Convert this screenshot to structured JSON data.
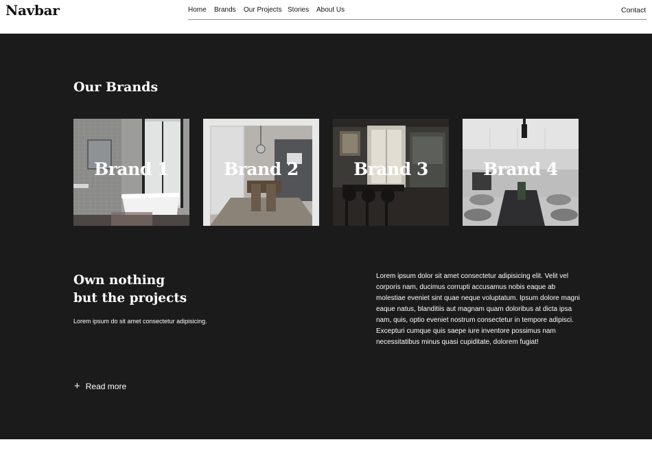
{
  "navbar": {
    "logo": "Navbar",
    "links": [
      "Home",
      "Brands",
      "Our Projects",
      "Stories",
      "About Us"
    ],
    "contact": "Contact"
  },
  "brands": {
    "title": "Our Brands",
    "items": [
      {
        "label": "Brand 1",
        "image": "bathroom-photo"
      },
      {
        "label": "Brand 2",
        "image": "dining-room-photo"
      },
      {
        "label": "Brand 3",
        "image": "dark-dining-photo"
      },
      {
        "label": "Brand 4",
        "image": "kitchen-photo"
      }
    ]
  },
  "about": {
    "heading_line1": "Own nothing",
    "heading_line2": "but the projects",
    "subtext": "Lorem ipsum do sit amet consectetur adipisicing.",
    "paragraph": "Lorem ipsum dolor sit amet consectetur adipisicing elit. Velit vel corporis nam, ducimus corrupti accusamus nobis eaque ab molestiae eveniet sint quae neque voluptatum. Ipsum dolore magni eaque natus, blanditiis aut magnam quam doloribus at dicta ipsa nam, quis, optio eveniet nostrum consectetur in tempore adipisci. Excepturi cumque quis saepe iure inventore possimus nam necessitatibus minus quasi cupiditate, dolorem fugiat!",
    "read_more": "Read more",
    "read_more_icon": "plus-icon"
  },
  "colors": {
    "dark_bg": "#1b1b1c",
    "text_light": "#ffffff",
    "nav_text": "#111111"
  }
}
